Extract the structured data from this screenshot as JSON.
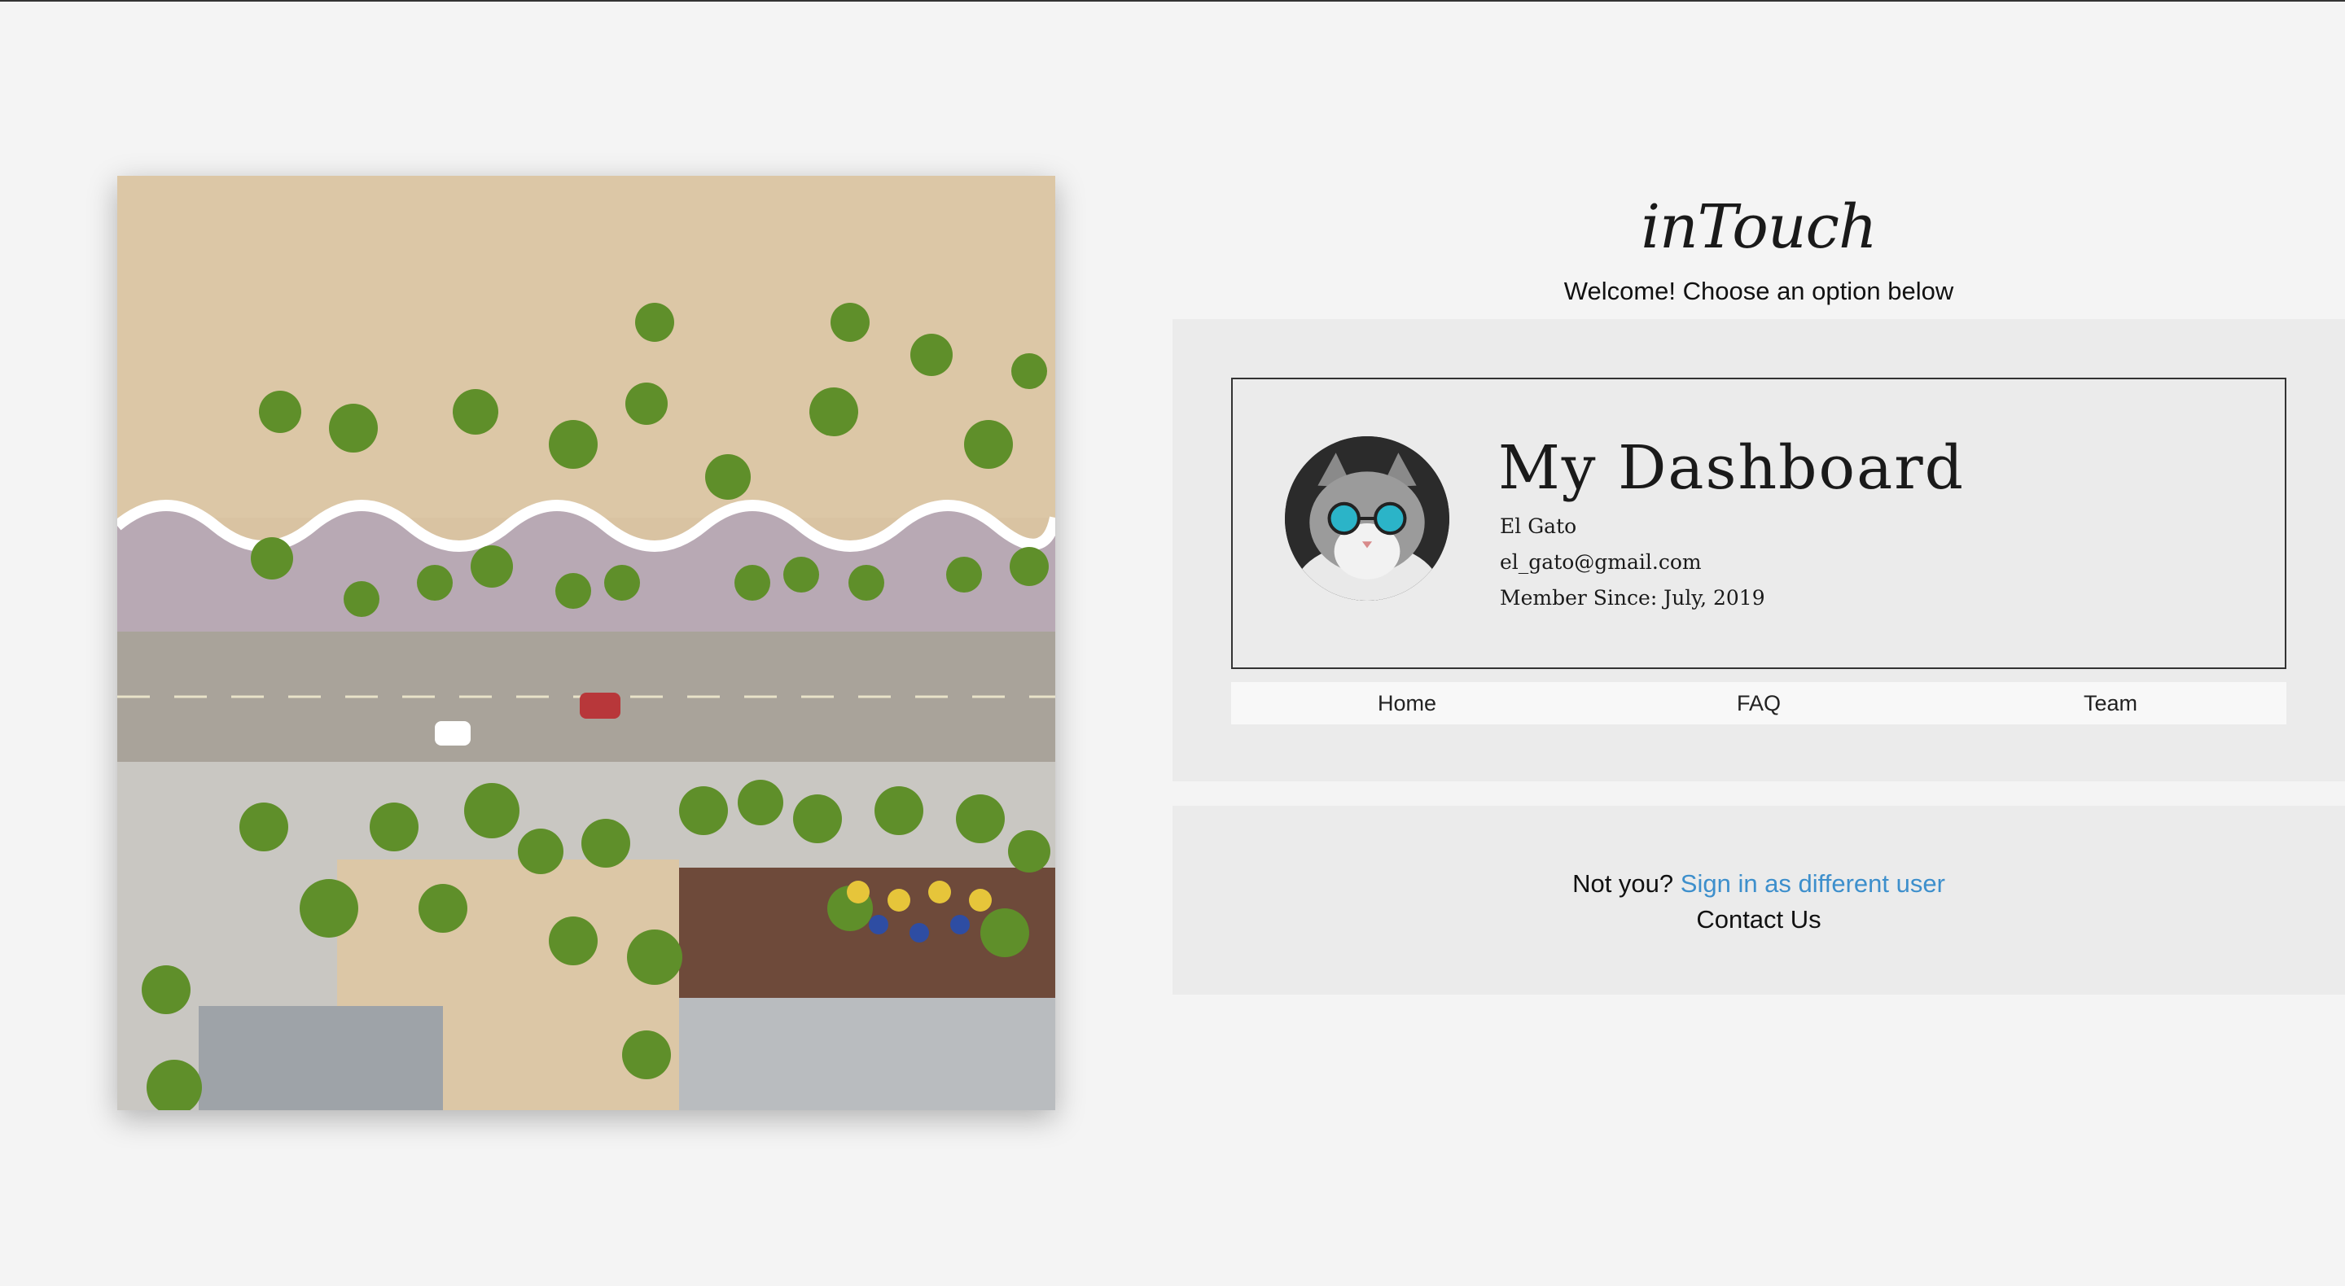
{
  "brand": {
    "title": "inTouch"
  },
  "welcome_text": "Welcome! Choose an option below",
  "profile": {
    "heading": "My Dashboard",
    "name": "El Gato",
    "email": "el_gato@gmail.com",
    "member_since": "Member Since: July, 2019"
  },
  "nav": {
    "items": [
      "Home",
      "FAQ",
      "Team"
    ]
  },
  "footer": {
    "not_you": "Not you? ",
    "switch_link": "Sign in as different user",
    "contact": "Contact Us"
  },
  "colors": {
    "background": "#f4f4f4",
    "panel": "#ebebeb",
    "link": "#3d8fcc"
  }
}
